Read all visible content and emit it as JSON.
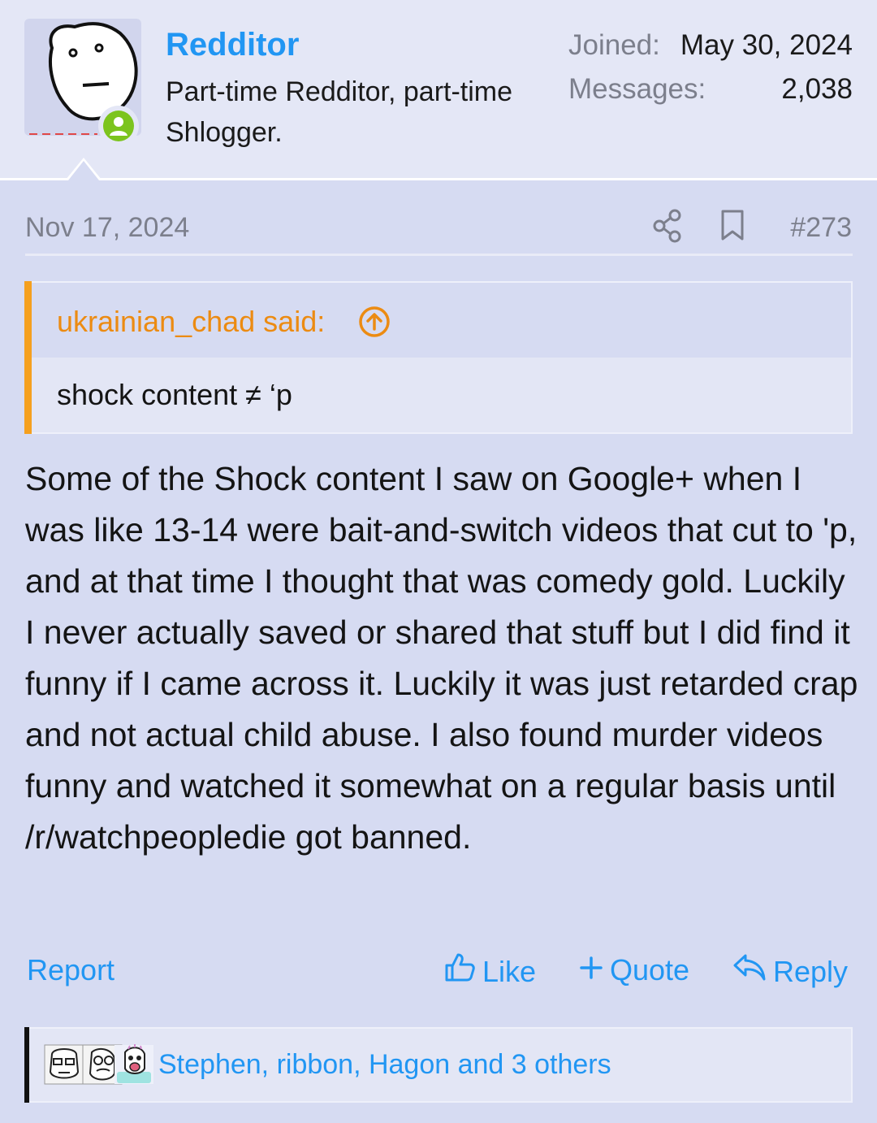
{
  "user": {
    "name": "Redditor",
    "title": "Part-time Redditor, part-time Shlogger.",
    "stats": [
      {
        "label": "Joined:",
        "value": "May 30, 2024"
      },
      {
        "label": "Messages:",
        "value": "2,038"
      }
    ]
  },
  "post": {
    "date": "Nov 17, 2024",
    "number": "#273",
    "quote": {
      "author": "ukrainian_chad said:",
      "text": "shock content ≠ ‘p"
    },
    "message": "Some of the Shock content I saw on Google+ when I was like 13-14 were bait-and-switch videos that cut to 'p, and at that time I thought that was comedy gold. Luckily I never actually saved or shared that stuff but I did find it funny if I came across it. Luckily it was just retarded crap and not actual child abuse. I also found murder videos funny and watched it somewhat on a regular basis until /r/watchpeopledie got banned."
  },
  "actions": {
    "report": "Report",
    "like": "Like",
    "quote": "Quote",
    "reply": "Reply"
  },
  "reactions": {
    "summary": "Stephen, ribbon, Hagon and 3 others"
  },
  "icons": [
    "online-status-icon",
    "share-icon",
    "bookmark-icon",
    "arrow-up-circle-icon",
    "thumbs-up-icon",
    "plus-icon",
    "reply-arrow-icon"
  ],
  "colors": {
    "background": "#d6dbf2",
    "header_background": "#e4e7f6",
    "link": "#2196f3",
    "quote_accent": "#f5a01f",
    "quote_author": "#ec8b12",
    "online": "#7cc41e",
    "muted": "#7c7f8c"
  }
}
